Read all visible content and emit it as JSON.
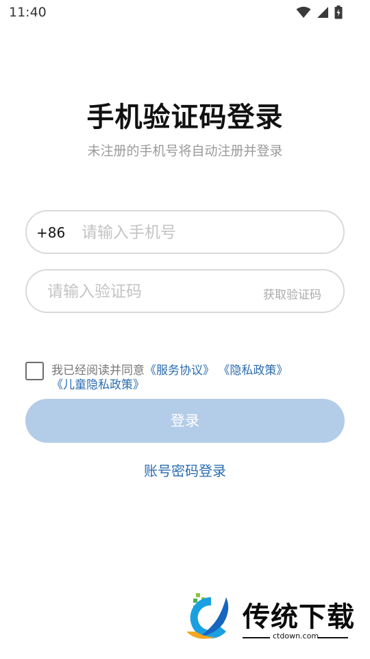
{
  "status_bar": {
    "time": "11:40",
    "icons": [
      "wifi-icon",
      "signal-icon",
      "battery-charging-icon"
    ]
  },
  "header": {
    "title": "手机验证码登录",
    "subtitle": "未注册的手机号将自动注册并登录"
  },
  "phone": {
    "country_code": "+86",
    "placeholder": "请输入手机号",
    "value": ""
  },
  "code": {
    "placeholder": "请输入验证码",
    "value": "",
    "get_code_label": "获取验证码"
  },
  "agreement": {
    "checked": false,
    "prefix": "我已经阅读并同意",
    "service_label": "《服务协议》",
    "privacy_label": "《隐私政策》",
    "children_privacy_label": "《儿童隐私政策》"
  },
  "login_button": {
    "label": "登录",
    "enabled": false
  },
  "alt_login": {
    "label": "账号密码登录"
  },
  "watermark": {
    "text": "传统下载",
    "url": "ctdown.com"
  },
  "colors": {
    "link": "#2a6cb0",
    "button_disabled": "#b3cce8",
    "border": "#d9d9d9",
    "placeholder": "#c3c3c3"
  }
}
